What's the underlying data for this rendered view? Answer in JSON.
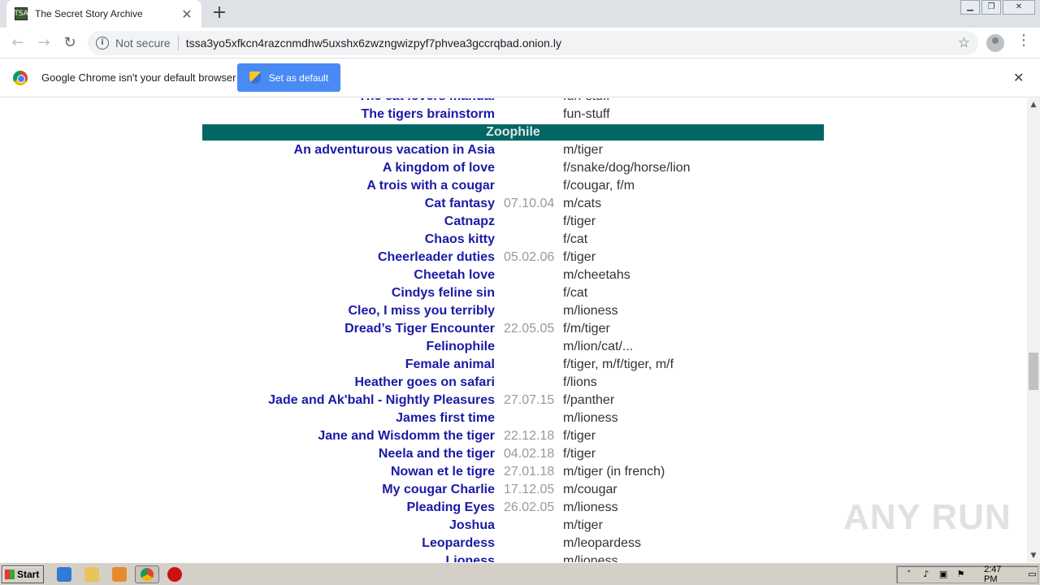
{
  "browser": {
    "tab_title": "The Secret Story Archive",
    "favicon_text": "TSA",
    "security_label": "Not secure",
    "url": "tssa3yo5xfkcn4razcnmdhw5uxshx6zwzngwizpyf7phvea3gccrqbad.onion.ly"
  },
  "infobar": {
    "message": "Google Chrome isn't your default browser",
    "button_label": "Set as default"
  },
  "listing": {
    "top_rows": [
      {
        "title": "The cat lovers manual",
        "date": "",
        "category": "fun-stuff"
      },
      {
        "title": "The tigers brainstorm",
        "date": "",
        "category": "fun-stuff"
      }
    ],
    "section_title": "Zoophile",
    "rows": [
      {
        "title": "An adventurous vacation in Asia",
        "date": "",
        "category": "m/tiger"
      },
      {
        "title": "A kingdom of love",
        "date": "",
        "category": "f/snake/dog/horse/lion"
      },
      {
        "title": "A trois with a cougar",
        "date": "",
        "category": "f/cougar, f/m"
      },
      {
        "title": "Cat fantasy",
        "date": "07.10.04",
        "category": "m/cats"
      },
      {
        "title": "Catnapz",
        "date": "",
        "category": "f/tiger"
      },
      {
        "title": "Chaos kitty",
        "date": "",
        "category": "f/cat"
      },
      {
        "title": "Cheerleader duties",
        "date": "05.02.06",
        "category": "f/tiger"
      },
      {
        "title": "Cheetah love",
        "date": "",
        "category": "m/cheetahs"
      },
      {
        "title": "Cindys feline sin",
        "date": "",
        "category": "f/cat"
      },
      {
        "title": "Cleo, I miss you terribly",
        "date": "",
        "category": "m/lioness"
      },
      {
        "title": "Dread’s Tiger Encounter",
        "date": "22.05.05",
        "category": "f/m/tiger"
      },
      {
        "title": "Felinophile",
        "date": "",
        "category": "m/lion/cat/..."
      },
      {
        "title": "Female animal",
        "date": "",
        "category": "f/tiger, m/f/tiger, m/f"
      },
      {
        "title": "Heather goes on safari",
        "date": "",
        "category": "f/lions"
      },
      {
        "title": "Jade and Ak'bahl - Nightly Pleasures",
        "date": "27.07.15",
        "category": "f/panther"
      },
      {
        "title": "James first time",
        "date": "",
        "category": "m/lioness"
      },
      {
        "title": "Jane and Wisdomm the tiger",
        "date": "22.12.18",
        "category": "f/tiger"
      },
      {
        "title": "Neela and the tiger",
        "date": "04.02.18",
        "category": "f/tiger"
      },
      {
        "title": "Nowan et le tigre",
        "date": "27.01.18",
        "category": "m/tiger (in french)"
      },
      {
        "title": "My cougar Charlie",
        "date": "17.12.05",
        "category": "m/cougar"
      },
      {
        "title": "Pleading Eyes",
        "date": "26.02.05",
        "category": "m/lioness"
      },
      {
        "title": "Joshua",
        "date": "",
        "category": "m/tiger"
      },
      {
        "title": "Leopardess",
        "date": "",
        "category": "m/leopardess"
      },
      {
        "title": "Lioness",
        "date": "",
        "category": "m/lioness"
      }
    ]
  },
  "watermark": "ANY RUN",
  "taskbar": {
    "start_label": "Start",
    "clock": "2:47 PM"
  },
  "colors": {
    "section_bar": "#006666",
    "link": "#1a1aa6",
    "accent_button": "#4a8af4"
  }
}
